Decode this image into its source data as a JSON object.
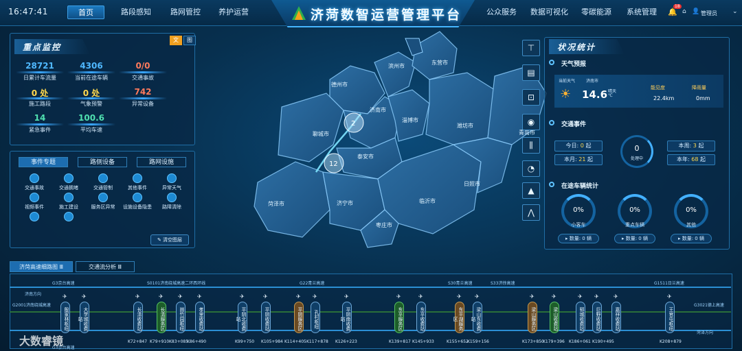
{
  "header": {
    "clock": "16:47:41",
    "title": "济菏数智运营管理平台",
    "nav_left": [
      "首页",
      "路段感知",
      "路网管控",
      "养护运营"
    ],
    "nav_right": [
      "公众服务",
      "数据可视化",
      "零碳能源",
      "系统管理"
    ],
    "notif_count": "18",
    "user": "管理员"
  },
  "key_monitor": {
    "title": "重点监控",
    "toggle": [
      "文",
      "图"
    ],
    "stats": [
      {
        "value": "28721",
        "label": "日累计车流量",
        "color": "#4fb8ff"
      },
      {
        "value": "4306",
        "label": "当前在途车辆",
        "color": "#4fb8ff"
      },
      {
        "value": "0/0",
        "label": "交通事故",
        "color": "#ff7a5c"
      },
      {
        "value": "0",
        "unit": "处",
        "label": "施工路段",
        "color": "#ffd84d"
      },
      {
        "value": "0",
        "unit": "处",
        "label": "气象预警",
        "color": "#ffd84d"
      },
      {
        "value": "742",
        "label": "异常设备",
        "color": "#ff7a5c"
      },
      {
        "value": "14",
        "label": "紧急事件",
        "color": "#4fe0b0"
      },
      {
        "value": "100.6",
        "label": "平均车速",
        "color": "#4fe0b0"
      }
    ]
  },
  "event_panel": {
    "tabs": [
      "事件专题",
      "路侧设备",
      "路网设施"
    ],
    "events": [
      "交通事故",
      "交通拥堵",
      "交通管制",
      "其他事件",
      "异常天气",
      "视频事件",
      "施工建设",
      "服务区异常",
      "设施设备隐患",
      "路障清除",
      "",
      ""
    ],
    "clear_button": "清空图层"
  },
  "map": {
    "cities": [
      "聊城市",
      "德州市",
      "济南市",
      "滨州市",
      "东营市",
      "淄博市",
      "潍坊市",
      "泰安市",
      "济宁市",
      "临沂市",
      "枣庄市",
      "日照市",
      "青岛市",
      "菏泽市"
    ],
    "clusters": [
      "2",
      "12"
    ]
  },
  "status_stats": {
    "title": "状况统计",
    "weather": {
      "title": "天气预报",
      "current": "当前天气",
      "city": "济南市",
      "temp": "14.6",
      "temp_unit": "℃",
      "cond": "晴天",
      "visibility_label": "能见度",
      "visibility": "22.4km",
      "rain_label": "降雨量",
      "rain": "0mm"
    },
    "traffic": {
      "title": "交通事件",
      "today_label": "今日:",
      "today": "0",
      "month_label": "本月:",
      "month": "21",
      "week_label": "本周:",
      "week": "3",
      "year_label": "本年:",
      "year": "68",
      "unit": "起",
      "center_value": "0",
      "center_label": "处理中"
    },
    "vehicles": {
      "title": "在途车辆统计",
      "items": [
        {
          "pct": "0%",
          "label": "小客车",
          "btn": "数量: 0 辆"
        },
        {
          "pct": "0%",
          "label": "重点车辆",
          "btn": "数量: 0 辆"
        },
        {
          "pct": "0%",
          "label": "其他",
          "btn": "数量: 0 辆"
        }
      ]
    }
  },
  "bottom": {
    "tabs": [
      "济菏高速细路图",
      "交通流分析"
    ],
    "top_roads": [
      "G3京台高速",
      "S0101济南绕城高速二环西环线",
      "G22青兰高速",
      "S30青兰高速",
      "S33济徐高速",
      "G1511日兰高速"
    ],
    "left_end": "G2001济南绕城高速",
    "right_end": "G3021德上高速",
    "dir_left": "济南方向",
    "dir_right": "菏泽方向",
    "bottom_left": "G3京台高速",
    "stations": [
      "殷家林枢纽",
      "大学城收费站",
      "长清收费站",
      "长清服务区",
      "崮竹园枢纽",
      "孝里收费站",
      "平阴北收费站",
      "平阴收费站",
      "平阴服务区",
      "孔村枢纽",
      "平阴南收费站",
      "东平服务区",
      "东平收费站",
      "东平湖服务区",
      "梁山东收费站",
      "梁山服务区",
      "梁山收费站",
      "郓城收费站",
      "巨野收费站",
      "嘉祥收费站",
      "王官屯枢纽"
    ],
    "km": [
      "K72+847",
      "K79+910",
      "K83+085",
      "K86+490",
      "K99+750",
      "K105+984",
      "K114+405",
      "K117+878",
      "K126+223",
      "K139+817",
      "K145+933",
      "K155+652",
      "K159+156",
      "K173+850",
      "K179+396",
      "K186+061",
      "K190+495",
      "K208+879"
    ]
  },
  "watermark": "大数睿镜"
}
